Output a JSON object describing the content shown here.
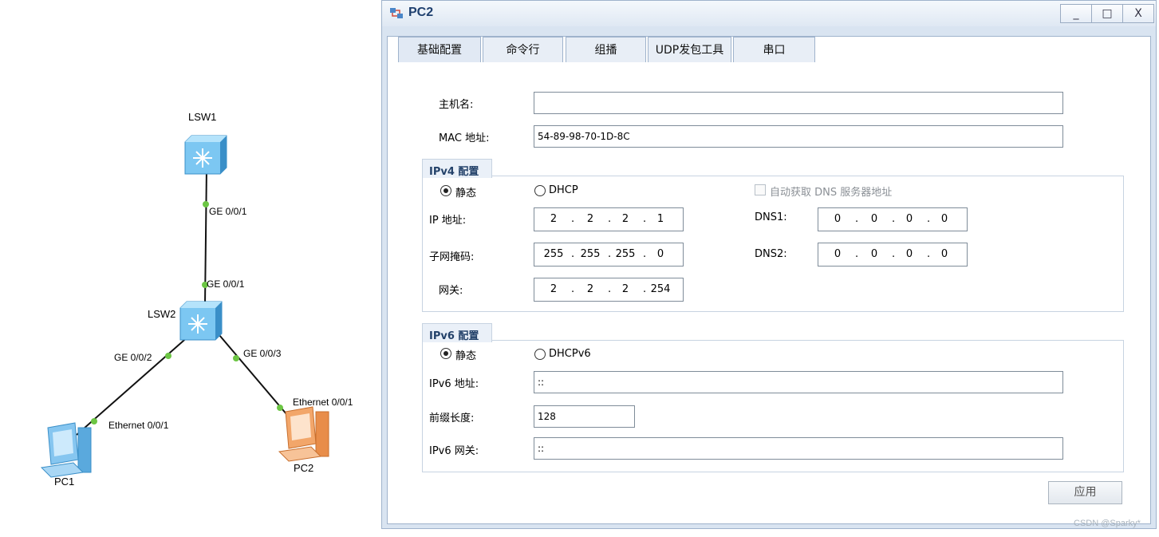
{
  "topology": {
    "devices": [
      {
        "id": "lsw1",
        "label": "LSW1"
      },
      {
        "id": "lsw2",
        "label": "LSW2"
      },
      {
        "id": "pc1",
        "label": "PC1"
      },
      {
        "id": "pc2",
        "label": "PC2"
      }
    ],
    "ports": [
      {
        "id": "lsw1-ge001",
        "label": "GE 0/0/1"
      },
      {
        "id": "lsw2-ge001",
        "label": "GE 0/0/1"
      },
      {
        "id": "lsw2-ge002",
        "label": "GE 0/0/2"
      },
      {
        "id": "lsw2-ge003",
        "label": "GE 0/0/3"
      },
      {
        "id": "pc1-eth",
        "label": "Ethernet 0/0/1"
      },
      {
        "id": "pc2-eth",
        "label": "Ethernet 0/0/1"
      }
    ],
    "colors": {
      "link": "#111111",
      "port_dot": "#6cc644",
      "switch": "#7cc7f2",
      "pc1": "#86c6f0",
      "pc2": "#f2a66a"
    }
  },
  "window": {
    "title": "PC2",
    "controls": {
      "minimize": "_",
      "maximize": "□",
      "close": "X"
    },
    "tabs": [
      {
        "label": "基础配置",
        "active": true
      },
      {
        "label": "命令行",
        "active": false
      },
      {
        "label": "组播",
        "active": false
      },
      {
        "label": "UDP发包工具",
        "active": false
      },
      {
        "label": "串口",
        "active": false
      }
    ]
  },
  "basic": {
    "hostname_label": "主机名:",
    "hostname_value": "",
    "mac_label": "MAC 地址:",
    "mac_value": "54-89-98-70-1D-8C"
  },
  "ipv4": {
    "section_title": "IPv4 配置",
    "static_label": "静态",
    "dhcp_label": "DHCP",
    "mode": "static",
    "auto_dns_label": "自动获取 DNS 服务器地址",
    "auto_dns_checked": false,
    "ip_label": "IP 地址:",
    "ip": [
      "2",
      "2",
      "2",
      "1"
    ],
    "mask_label": "子网掩码:",
    "mask": [
      "255",
      "255",
      "255",
      "0"
    ],
    "gateway_label": "网关:",
    "gateway": [
      "2",
      "2",
      "2",
      "254"
    ],
    "dns1_label": "DNS1:",
    "dns1": [
      "0",
      "0",
      "0",
      "0"
    ],
    "dns2_label": "DNS2:",
    "dns2": [
      "0",
      "0",
      "0",
      "0"
    ]
  },
  "ipv6": {
    "section_title": "IPv6 配置",
    "static_label": "静态",
    "dhcp_label": "DHCPv6",
    "mode": "static",
    "addr_label": "IPv6 地址:",
    "addr_value": "::",
    "prefix_label": "前缀长度:",
    "prefix_value": "128",
    "gateway_label": "IPv6 网关:",
    "gateway_value": "::"
  },
  "apply_label": "应用",
  "watermark": "CSDN @Sparky*"
}
